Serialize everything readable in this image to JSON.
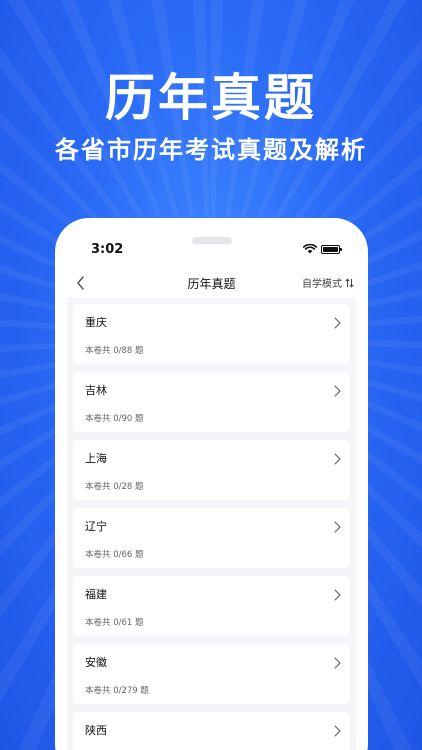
{
  "hero": {
    "title": "历年真题",
    "subtitle": "各省市历年考试真题及解析"
  },
  "status_bar": {
    "time": "3:02",
    "icons": [
      "wifi-icon",
      "battery-icon"
    ]
  },
  "nav": {
    "title": "历年真题",
    "mode_label": "自学模式",
    "icons": [
      "back-chevron-icon",
      "sort-arrows-icon"
    ]
  },
  "papers": [
    {
      "name": "重庆",
      "count": "本卷共 0/88 题"
    },
    {
      "name": "吉林",
      "count": "本卷共 0/90 题"
    },
    {
      "name": "上海",
      "count": "本卷共 0/28 题"
    },
    {
      "name": "辽宁",
      "count": "本卷共 0/66 题"
    },
    {
      "name": "福建",
      "count": "本卷共 0/61 题"
    },
    {
      "name": "安徽",
      "count": "本卷共 0/279 题"
    },
    {
      "name": "陕西",
      "count": ""
    }
  ],
  "colors": {
    "background": "#2a6af5",
    "list_background": "#f4f5f8",
    "card": "#ffffff"
  }
}
